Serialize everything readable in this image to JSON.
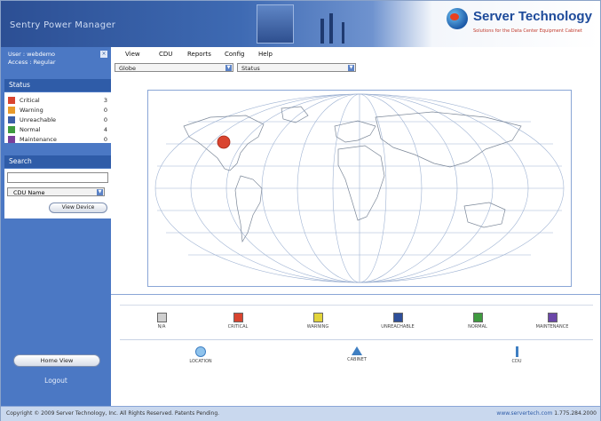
{
  "header": {
    "app_title": "Sentry Power Manager",
    "brand_name": "Server Technology",
    "brand_tagline": "Solutions for the Data Center Equipment Cabinet"
  },
  "user": {
    "user_line": "User : webdemo",
    "access_line": "Access : Regular",
    "close_glyph": "×"
  },
  "status": {
    "heading": "Status",
    "items": [
      {
        "label": "Critical",
        "count": "3",
        "color": "#d9442f"
      },
      {
        "label": "Warning",
        "count": "0",
        "color": "#e89a2a"
      },
      {
        "label": "Unreachable",
        "count": "0",
        "color": "#3c5fa8"
      },
      {
        "label": "Normal",
        "count": "4",
        "color": "#3f9b3f"
      },
      {
        "label": "Maintenance",
        "count": "0",
        "color": "#7a3f9b"
      }
    ]
  },
  "search": {
    "heading": "Search",
    "input_value": "",
    "select_value": "CDU Name",
    "view_button": "View Device"
  },
  "sidebar_footer": {
    "home_view": "Home View",
    "logout": "Logout"
  },
  "menu": {
    "items": [
      "View",
      "CDU",
      "Reports",
      "Config",
      "Help"
    ]
  },
  "selectors": {
    "first": "Globe",
    "second": "Status"
  },
  "legend": {
    "status_items": [
      {
        "label": "N/A",
        "color": "#cfcfcf"
      },
      {
        "label": "Critical",
        "color": "#d9442f"
      },
      {
        "label": "Warning",
        "color": "#e2d43a"
      },
      {
        "label": "Unreachable",
        "color": "#2e4f9a"
      },
      {
        "label": "Normal",
        "color": "#3f9b3f"
      },
      {
        "label": "Maintenance",
        "color": "#6b47a8"
      }
    ],
    "type_items": [
      {
        "label": "Location",
        "icon": "location-icon"
      },
      {
        "label": "Cabinet",
        "icon": "cabinet-icon"
      },
      {
        "label": "CDU",
        "icon": "cdu-icon"
      }
    ]
  },
  "footer": {
    "copyright": "Copyright © 2009 Server Technology, Inc. All Rights Reserved. Patents Pending.",
    "url": "www.servertech.com",
    "phone": "1.775.284.2000"
  },
  "map": {
    "marker_status_color": "#d9442f"
  }
}
